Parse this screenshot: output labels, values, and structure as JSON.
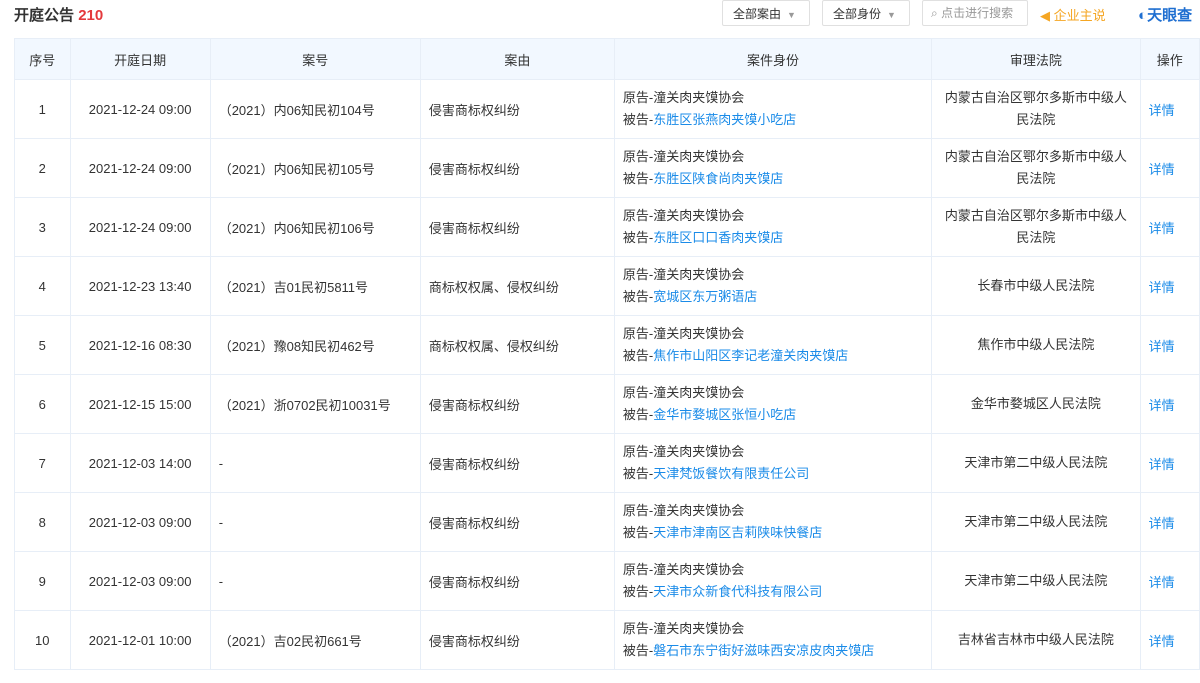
{
  "header": {
    "title": "开庭公告",
    "count": "210",
    "filter_cause": "全部案由",
    "filter_role": "全部身份",
    "search_placeholder": "点击进行搜索",
    "enterprise_say": "企业主说",
    "logo": "天眼查"
  },
  "colors": {
    "accent": "#1a8be8",
    "count": "#e4393c",
    "enterprise": "#f5a623"
  },
  "table": {
    "columns": [
      "序号",
      "开庭日期",
      "案号",
      "案由",
      "案件身份",
      "审理法院",
      "操作"
    ],
    "rows": [
      {
        "no": "1",
        "date": "2021-12-24 09:00",
        "case": "（2021）内06知民初104号",
        "cause": "侵害商标权纠纷",
        "plaintiff_label": "原告-",
        "plaintiff": "潼关肉夹馍协会",
        "defendant_label": "被告-",
        "defendant": "东胜区张燕肉夹馍小吃店",
        "court": "内蒙古自治区鄂尔多斯市中级人民法院",
        "action": "详情"
      },
      {
        "no": "2",
        "date": "2021-12-24 09:00",
        "case": "（2021）内06知民初105号",
        "cause": "侵害商标权纠纷",
        "plaintiff_label": "原告-",
        "plaintiff": "潼关肉夹馍协会",
        "defendant_label": "被告-",
        "defendant": "东胜区陕食尚肉夹馍店",
        "court": "内蒙古自治区鄂尔多斯市中级人民法院",
        "action": "详情"
      },
      {
        "no": "3",
        "date": "2021-12-24 09:00",
        "case": "（2021）内06知民初106号",
        "cause": "侵害商标权纠纷",
        "plaintiff_label": "原告-",
        "plaintiff": "潼关肉夹馍协会",
        "defendant_label": "被告-",
        "defendant": "东胜区口口香肉夹馍店",
        "court": "内蒙古自治区鄂尔多斯市中级人民法院",
        "action": "详情"
      },
      {
        "no": "4",
        "date": "2021-12-23 13:40",
        "case": "（2021）吉01民初5811号",
        "cause": "商标权权属、侵权纠纷",
        "plaintiff_label": "原告-",
        "plaintiff": "潼关肉夹馍协会",
        "defendant_label": "被告-",
        "defendant": "宽城区东万粥语店",
        "court": "长春市中级人民法院",
        "action": "详情"
      },
      {
        "no": "5",
        "date": "2021-12-16 08:30",
        "case": "（2021）豫08知民初462号",
        "cause": "商标权权属、侵权纠纷",
        "plaintiff_label": "原告-",
        "plaintiff": "潼关肉夹馍协会",
        "defendant_label": "被告-",
        "defendant": "焦作市山阳区李记老潼关肉夹馍店",
        "court": "焦作市中级人民法院",
        "action": "详情"
      },
      {
        "no": "6",
        "date": "2021-12-15 15:00",
        "case": "（2021）浙0702民初10031号",
        "cause": "侵害商标权纠纷",
        "plaintiff_label": "原告-",
        "plaintiff": "潼关肉夹馍协会",
        "defendant_label": "被告-",
        "defendant": "金华市婺城区张恒小吃店",
        "court": "金华市婺城区人民法院",
        "action": "详情"
      },
      {
        "no": "7",
        "date": "2021-12-03 14:00",
        "case": "-",
        "cause": "侵害商标权纠纷",
        "plaintiff_label": "原告-",
        "plaintiff": "潼关肉夹馍协会",
        "defendant_label": "被告-",
        "defendant": "天津梵饭餐饮有限责任公司",
        "court": "天津市第二中级人民法院",
        "action": "详情"
      },
      {
        "no": "8",
        "date": "2021-12-03 09:00",
        "case": "-",
        "cause": "侵害商标权纠纷",
        "plaintiff_label": "原告-",
        "plaintiff": "潼关肉夹馍协会",
        "defendant_label": "被告-",
        "defendant": "天津市津南区吉莉陕味快餐店",
        "court": "天津市第二中级人民法院",
        "action": "详情"
      },
      {
        "no": "9",
        "date": "2021-12-03 09:00",
        "case": "-",
        "cause": "侵害商标权纠纷",
        "plaintiff_label": "原告-",
        "plaintiff": "潼关肉夹馍协会",
        "defendant_label": "被告-",
        "defendant": "天津市众新食代科技有限公司",
        "court": "天津市第二中级人民法院",
        "action": "详情"
      },
      {
        "no": "10",
        "date": "2021-12-01 10:00",
        "case": "（2021）吉02民初661号",
        "cause": "侵害商标权纠纷",
        "plaintiff_label": "原告-",
        "plaintiff": "潼关肉夹馍协会",
        "defendant_label": "被告-",
        "defendant": "磐石市东宁街好滋味西安凉皮肉夹馍店",
        "court": "吉林省吉林市中级人民法院",
        "action": "详情"
      }
    ]
  }
}
